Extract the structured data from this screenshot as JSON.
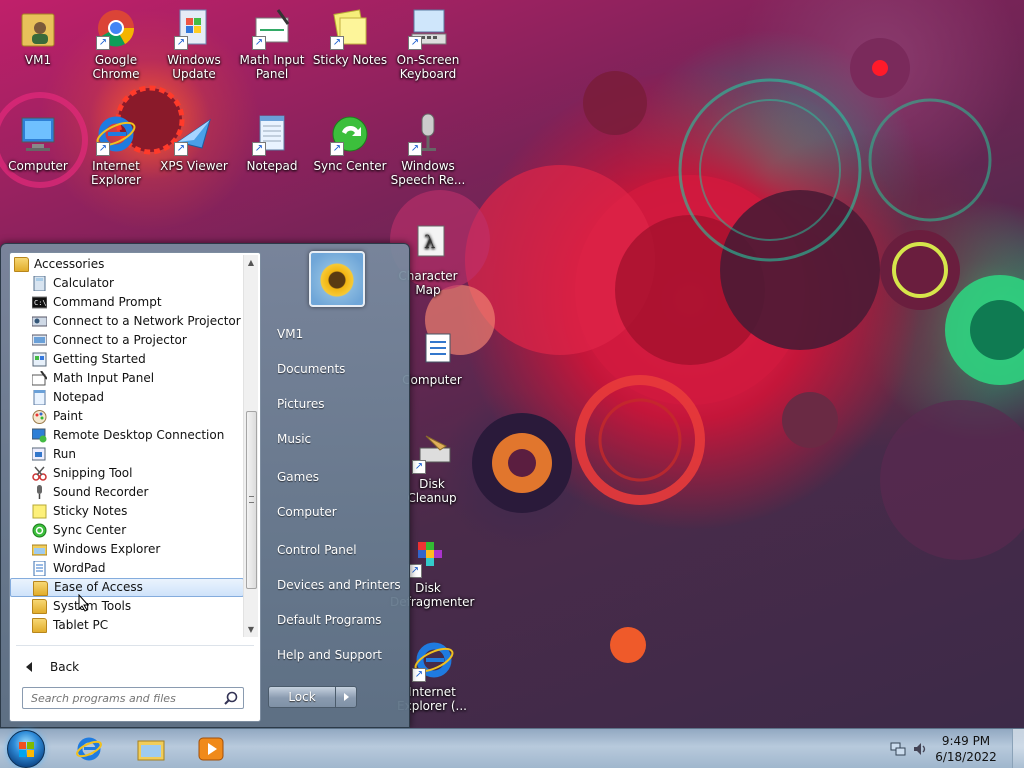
{
  "desktop": {
    "icons": [
      {
        "label": "VM1",
        "icon": "user-folder-icon"
      },
      {
        "label": "Google Chrome",
        "icon": "chrome-icon"
      },
      {
        "label": "Windows Update",
        "icon": "windows-update-icon"
      },
      {
        "label": "Math Input Panel",
        "icon": "math-input-icon"
      },
      {
        "label": "Sticky Notes",
        "icon": "sticky-notes-icon"
      },
      {
        "label": "On-Screen Keyboard",
        "icon": "keyboard-icon"
      },
      {
        "label": "Computer",
        "icon": "computer-icon"
      },
      {
        "label": "Internet Explorer",
        "icon": "internet-explorer-icon"
      },
      {
        "label": "XPS Viewer",
        "icon": "xps-viewer-icon"
      },
      {
        "label": "Notepad",
        "icon": "notepad-icon"
      },
      {
        "label": "Sync Center",
        "icon": "sync-center-icon"
      },
      {
        "label": "Windows Speech Re...",
        "icon": "microphone-icon"
      },
      {
        "label": "Character Map",
        "icon": "character-map-icon"
      },
      {
        "label": "Computer",
        "icon": "computer-management-icon"
      },
      {
        "label": "Disk Cleanup",
        "icon": "disk-cleanup-icon"
      },
      {
        "label": "Disk Defragmenter",
        "icon": "disk-defragmenter-icon"
      },
      {
        "label": "Internet Explorer (...",
        "icon": "internet-explorer-icon"
      }
    ]
  },
  "start_menu": {
    "programs": [
      {
        "label": "Accessories",
        "icon": "folder-icon"
      },
      {
        "label": "Calculator",
        "icon": "calculator-icon"
      },
      {
        "label": "Command Prompt",
        "icon": "command-prompt-icon"
      },
      {
        "label": "Connect to a Network Projector",
        "icon": "network-projector-icon"
      },
      {
        "label": "Connect to a Projector",
        "icon": "projector-icon"
      },
      {
        "label": "Getting Started",
        "icon": "getting-started-icon"
      },
      {
        "label": "Math Input Panel",
        "icon": "math-input-icon"
      },
      {
        "label": "Notepad",
        "icon": "notepad-icon"
      },
      {
        "label": "Paint",
        "icon": "paint-icon"
      },
      {
        "label": "Remote Desktop Connection",
        "icon": "remote-desktop-icon"
      },
      {
        "label": "Run",
        "icon": "run-icon"
      },
      {
        "label": "Snipping Tool",
        "icon": "snipping-tool-icon"
      },
      {
        "label": "Sound Recorder",
        "icon": "microphone-icon"
      },
      {
        "label": "Sticky Notes",
        "icon": "sticky-notes-icon"
      },
      {
        "label": "Sync Center",
        "icon": "sync-center-icon"
      },
      {
        "label": "Windows Explorer",
        "icon": "windows-explorer-icon"
      },
      {
        "label": "WordPad",
        "icon": "wordpad-icon"
      },
      {
        "label": "Ease of Access",
        "icon": "folder-icon"
      },
      {
        "label": "System Tools",
        "icon": "folder-icon"
      },
      {
        "label": "Tablet PC",
        "icon": "folder-icon"
      }
    ],
    "selected_program": "Ease of Access",
    "back_label": "Back",
    "search_placeholder": "Search programs and files",
    "right_items": [
      {
        "label": "VM1"
      },
      {
        "label": "Documents"
      },
      {
        "label": "Pictures"
      },
      {
        "label": "Music"
      },
      {
        "label": "Games"
      },
      {
        "label": "Computer"
      },
      {
        "label": "Control Panel"
      },
      {
        "label": "Devices and Printers"
      },
      {
        "label": "Default Programs"
      },
      {
        "label": "Help and Support"
      }
    ],
    "lock_label": "Lock"
  },
  "taskbar": {
    "start_icon": "windows-orb-icon",
    "pinned": [
      {
        "name": "internet-explorer",
        "icon": "internet-explorer-icon"
      },
      {
        "name": "windows-explorer",
        "icon": "windows-explorer-icon"
      },
      {
        "name": "media-player",
        "icon": "media-player-icon"
      }
    ],
    "clock_time": "9:49 PM",
    "clock_date": "6/18/2022"
  },
  "colors": {
    "selection": "#cfe3fa",
    "taskbar": "#bcd2e6",
    "start_menu_glass": "#7a8ca0"
  }
}
